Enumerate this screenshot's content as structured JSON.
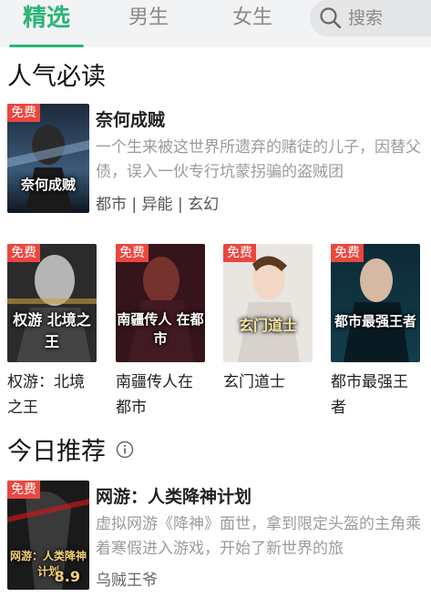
{
  "tabs": [
    {
      "label": "精选",
      "active": true
    },
    {
      "label": "男生",
      "active": false
    },
    {
      "label": "女生",
      "active": false
    }
  ],
  "search": {
    "placeholder": "搜索",
    "icon": "search-icon"
  },
  "popular": {
    "title": "人气必读",
    "featured": {
      "badge": "免费",
      "cover_text": "奈何成贼",
      "title": "奈何成贼",
      "desc": "一个生来被这世界所遗弃的赌徒的儿子，因替父债，误入一伙专行坑蒙拐骗的盗贼团",
      "tags": "都市 | 异能 | 玄幻"
    },
    "grid": [
      {
        "badge": "免费",
        "cover_text": "权游 北境之王",
        "title": "权游：北境之王"
      },
      {
        "badge": "免费",
        "cover_text": "南疆传人 在都市",
        "title": "南疆传人在都市"
      },
      {
        "badge": "免费",
        "cover_text": "玄门道士",
        "title": "玄门道士"
      },
      {
        "badge": "免费",
        "cover_text": "都市最强王者",
        "title": "都市最强王者"
      }
    ]
  },
  "today": {
    "title": "今日推荐",
    "info_icon": "info-icon",
    "book": {
      "badge": "免费",
      "cover_text": "网游：人类降神计划",
      "cover_score": "8.9",
      "title": "网游：人类降神计划",
      "desc": "虚拟网游《降神》面世，拿到限定头盔的主角乘着寒假进入游戏，开始了新世界的旅",
      "author": "乌贼王爷"
    }
  },
  "colors": {
    "accent": "#2bb477",
    "badge": "#e9473f"
  }
}
